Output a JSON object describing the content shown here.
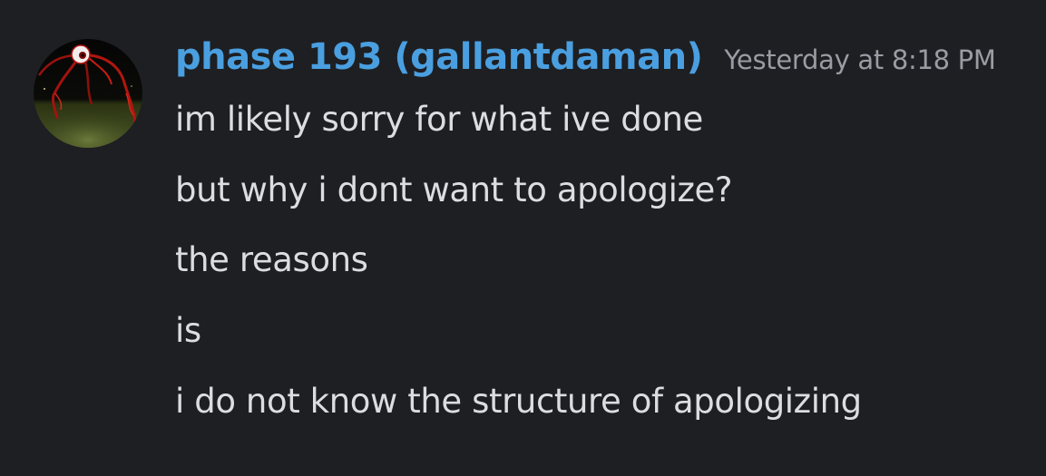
{
  "message": {
    "author": {
      "display_name": "phase 193 (gallantdaman)",
      "avatar_icon": "dark-night-field-eyeball-creature-avatar"
    },
    "timestamp": "Yesterday at 8:18 PM",
    "lines": [
      "im likely sorry for what ive done",
      "but why i dont want to apologize?",
      "the reasons",
      "is",
      "i do not know the structure of apologizing"
    ]
  },
  "colors": {
    "background": "#1e1f22",
    "username": "#4a9fe0",
    "timestamp": "#9a9ca3",
    "message_text": "#dcdde0"
  }
}
